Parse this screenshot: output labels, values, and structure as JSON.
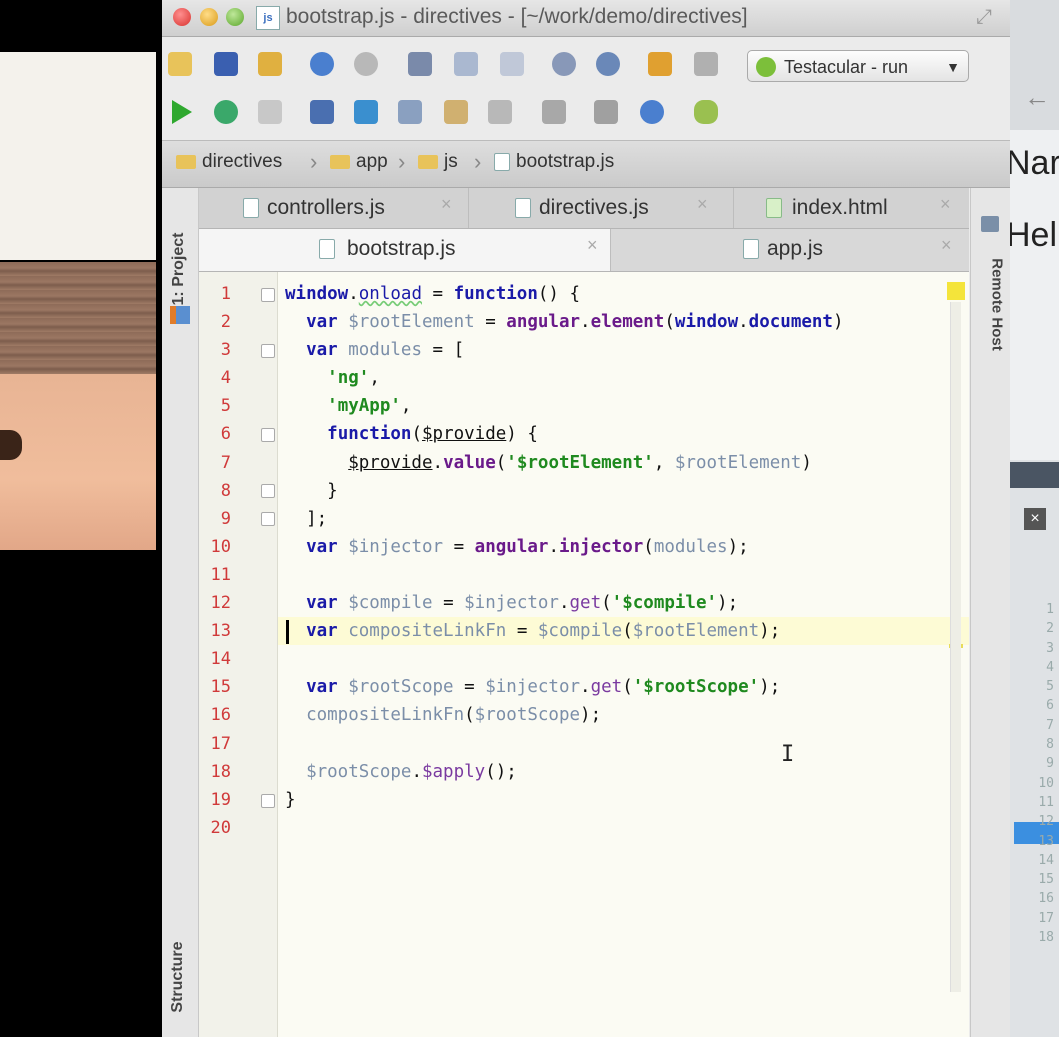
{
  "window": {
    "title": "bootstrap.js - directives - [~/work/demo/directives]",
    "title_icon": "js"
  },
  "toolbar": {
    "run_config": "Testacular - run",
    "run_config_arrow": "▼"
  },
  "breadcrumb": [
    "directives",
    "app",
    "js",
    "bootstrap.js"
  ],
  "side_tools": {
    "project": "1: Project",
    "structure": "Structure",
    "remote_host": "Remote Host"
  },
  "tabs_row1": [
    {
      "label": "controllers.js",
      "close": "×"
    },
    {
      "label": "directives.js",
      "close": "×"
    },
    {
      "label": "index.html",
      "close": "×"
    }
  ],
  "tabs_row2": [
    {
      "label": "bootstrap.js",
      "close": "×"
    },
    {
      "label": "app.js",
      "close": "×"
    }
  ],
  "editor": {
    "line_numbers": [
      "1",
      "2",
      "3",
      "4",
      "5",
      "6",
      "7",
      "8",
      "9",
      "10",
      "11",
      "12",
      "13",
      "14",
      "15",
      "16",
      "17",
      "18",
      "19",
      "20"
    ]
  },
  "background_browser": {
    "text_a": "Nar",
    "text_b": "Hel",
    "line_numbers": [
      "1",
      "2",
      "3",
      "4",
      "5",
      "6",
      "7",
      "8",
      "9",
      "10",
      "11",
      "12",
      "13",
      "14",
      "15",
      "16",
      "17",
      "18"
    ]
  }
}
